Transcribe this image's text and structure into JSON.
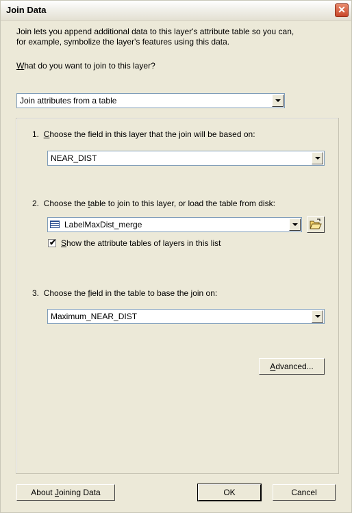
{
  "window": {
    "title": "Join Data",
    "close_glyph": "✕"
  },
  "intro": {
    "line1": "Join lets you append additional data to this layer's attribute table so you can,",
    "line2": "for example, symbolize the layer's features using this data."
  },
  "join_type": {
    "question_accel": "W",
    "question_rest": "hat do you want to join to this layer?",
    "selected": "Join attributes from a table"
  },
  "step1": {
    "num": "1.",
    "label_pre": "",
    "label_accel": "C",
    "label_rest": "hoose the field in this layer that the join will be based on:",
    "selected": "NEAR_DIST"
  },
  "step2": {
    "num": "2.",
    "label_pre": "Choose the ",
    "label_accel": "t",
    "label_rest": "able to join to this layer, or load the table from disk:",
    "selected": "LabelMaxDist_merge",
    "table_icon": "table-icon",
    "folder_icon": "open-folder-icon",
    "show_tables": {
      "checked": true,
      "check_glyph": "✔",
      "label_accel": "S",
      "label_rest": "how the attribute tables of layers in this list"
    }
  },
  "step3": {
    "num": "3.",
    "label_pre": "Choose the ",
    "label_accel": "f",
    "label_rest": "ield in the table to base the join on:",
    "selected": "Maximum_NEAR_DIST"
  },
  "buttons": {
    "advanced_accel": "A",
    "advanced_rest": "dvanced...",
    "about_pre": "About ",
    "about_accel": "J",
    "about_rest": "oining Data",
    "ok": "OK",
    "cancel": "Cancel"
  },
  "colors": {
    "dialog_bg": "#ece9d8",
    "close_red": "#c9472a",
    "field_border": "#7f9db9"
  }
}
